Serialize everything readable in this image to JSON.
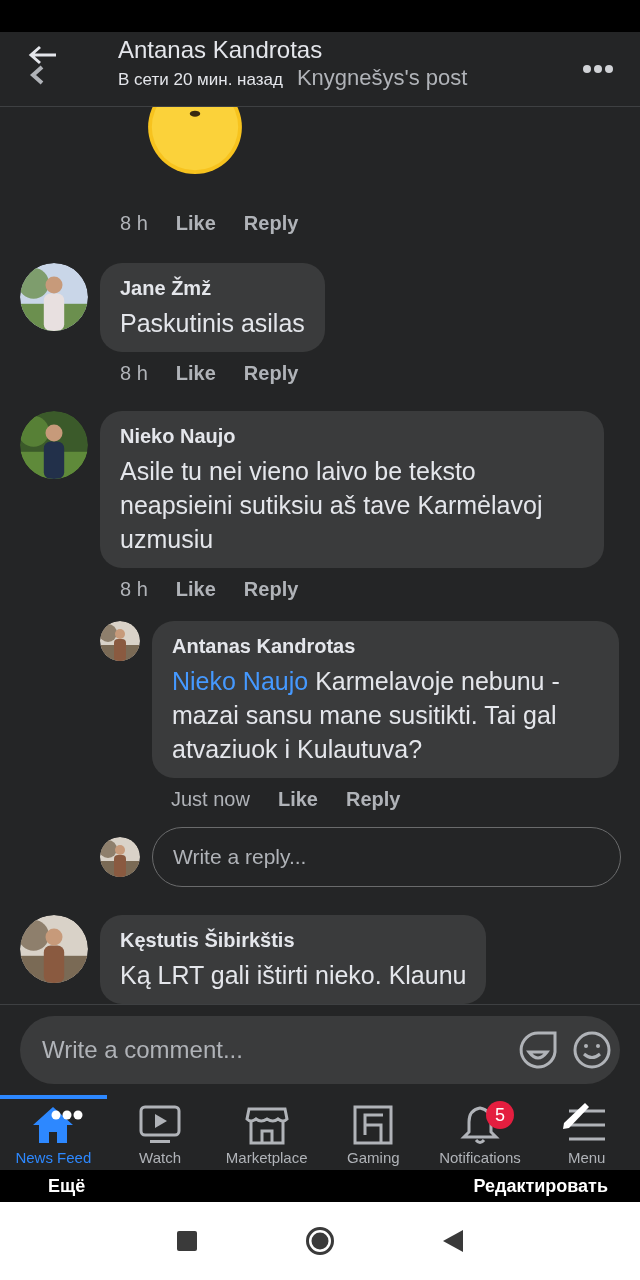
{
  "header": {
    "name": "Antanas Kandrotas",
    "status": "В сети 20 мин. назад",
    "title": "Knygnešys's post"
  },
  "post_meta": {
    "time": "8 h",
    "actions": [
      "Like",
      "Reply"
    ]
  },
  "comments": [
    {
      "author": "Jane Žmž",
      "text": "Paskutinis asilas",
      "time": "8 h",
      "actions": [
        "Like",
        "Reply"
      ]
    },
    {
      "author": "Nieko Naujo",
      "text": "Asile tu nei vieno laivo be teksto neapsieini sutiksiu aš tave Karmėlavoj uzmusiu",
      "time": "8 h",
      "actions": [
        "Like",
        "Reply"
      ],
      "replies": [
        {
          "author": "Antanas Kandrotas",
          "mention": "Nieko Naujo",
          "text": "Karmelavoje nebunu - mazai sansu mane susitikti. Tai gal atvaziuok i Kulautuva?",
          "time": "Just now",
          "actions": [
            "Like",
            "Reply"
          ]
        }
      ],
      "reply_box": {
        "placeholder": "Write a reply..."
      }
    },
    {
      "author": "Kęstutis Šibirkštis",
      "text": "Ką LRT gali ištirti nieko. Klaunu"
    }
  ],
  "composer": {
    "placeholder": "Write a comment..."
  },
  "nav": [
    {
      "kind": "home",
      "label": "News Feed",
      "selected": true
    },
    {
      "kind": "watch",
      "label": "Watch",
      "selected": false
    },
    {
      "kind": "store",
      "label": "Marketplace",
      "selected": false
    },
    {
      "kind": "gaming",
      "label": "Gaming",
      "selected": false
    },
    {
      "kind": "bell",
      "label": "Notifications",
      "selected": false,
      "badge": "5"
    },
    {
      "kind": "menu",
      "label": "Menu",
      "selected": false
    }
  ],
  "overlay": {
    "left": "Ещё",
    "right": "Редактировать"
  }
}
